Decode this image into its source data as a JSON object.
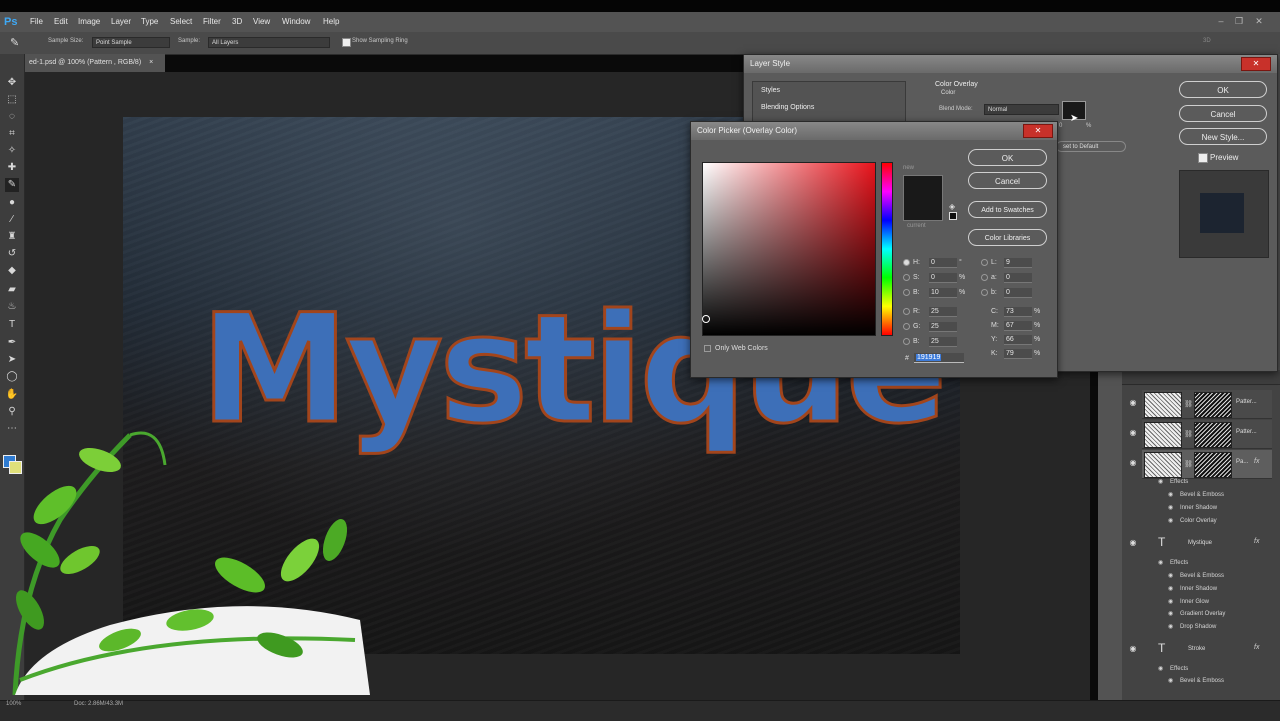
{
  "app": {
    "logo": "Ps",
    "menu": [
      "File",
      "Edit",
      "Image",
      "Layer",
      "Type",
      "Select",
      "Filter",
      "3D",
      "View",
      "Window",
      "Help"
    ],
    "window_controls": [
      "–",
      "❐",
      "✕"
    ]
  },
  "options_bar": {
    "sample_size_label": "Sample Size:",
    "sample_size_value": "Point Sample",
    "sample_label": "Sample:",
    "sample_value": "All Layers",
    "show_ring_label": "Show Sampling Ring",
    "right_label": "3D"
  },
  "document": {
    "tab_title": "ed-1.psd @ 100% (Pattern , RGB/8)",
    "tab_close": "×",
    "artwork_text": "Mystique"
  },
  "status_bar": {
    "zoom": "100%",
    "doc_info": "Doc: 2.86M/43.3M"
  },
  "layer_style": {
    "title": "Layer Style",
    "styles_label": "Styles",
    "blending_options_label": "Blending Options",
    "section_title": "Color Overlay",
    "section_sub": "Color",
    "blend_mode_label": "Blend Mode:",
    "blend_mode_value": "Normal",
    "opacity_value": "0",
    "opacity_unit": "%",
    "reset_default": "set to Default",
    "ok": "OK",
    "cancel": "Cancel",
    "new_style": "New Style...",
    "preview_label": "Preview"
  },
  "color_picker": {
    "title": "Color Picker (Overlay Color)",
    "ok": "OK",
    "cancel": "Cancel",
    "add_to_swatches": "Add to Swatches",
    "color_libraries": "Color Libraries",
    "new_label": "new",
    "current_label": "current",
    "only_web_colors": "Only Web Colors",
    "hex_prefix": "#",
    "hex_value": "191919",
    "fields": {
      "H": "0",
      "H_unit": "°",
      "S": "0",
      "S_unit": "%",
      "B": "10",
      "B_unit": "%",
      "R": "25",
      "G": "25",
      "Bl": "25",
      "L": "9",
      "a": "0",
      "b": "0",
      "C": "73",
      "M": "67",
      "Y": "66",
      "K": "79",
      "pct": "%"
    }
  },
  "layers": {
    "rows": [
      {
        "name": "Patter..."
      },
      {
        "name": "Patter..."
      },
      {
        "name": "Pa..."
      }
    ],
    "effects_label": "Effects",
    "pattern_effects": [
      "Bevel & Emboss",
      "Inner Shadow",
      "Color Overlay"
    ],
    "mystique_layer": "Mystique",
    "mystique_effects": [
      "Bevel & Emboss",
      "Inner Shadow",
      "Inner Glow",
      "Gradient Overlay",
      "Drop Shadow"
    ],
    "stroke_layer": "Stroke",
    "stroke_effects": [
      "Bevel & Emboss"
    ],
    "fx": "fx",
    "type_icon": "T"
  },
  "colors": {
    "accent_blue": "#3d6fb8",
    "close_red": "#c8312a",
    "current_color": "#191919"
  }
}
